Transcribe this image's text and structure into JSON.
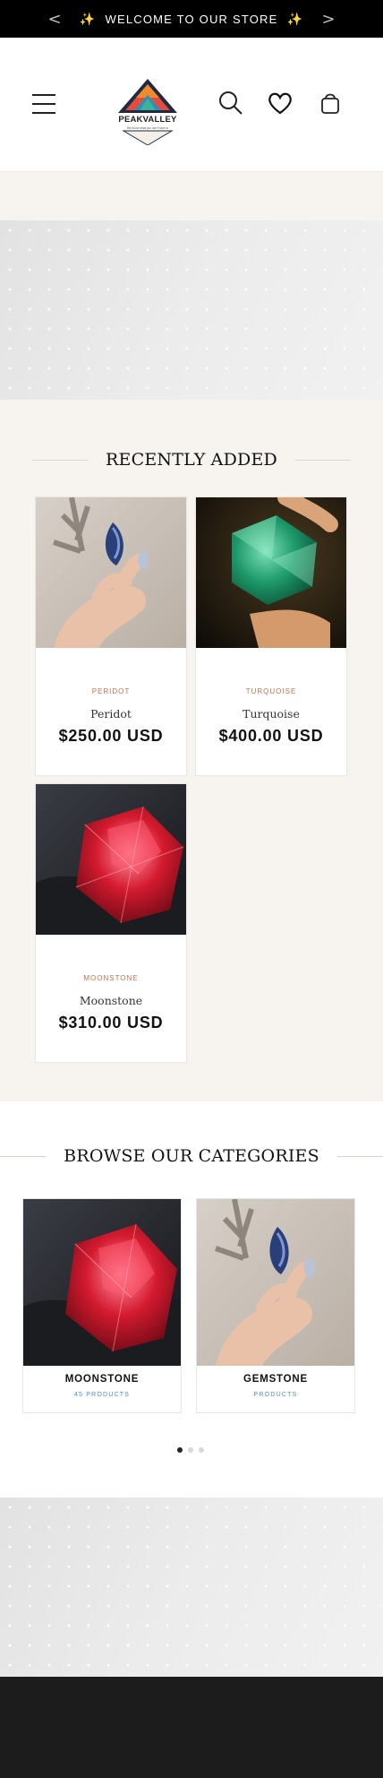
{
  "announcement": {
    "prev_label": "<",
    "next_label": ">",
    "spark_left": "✨",
    "text": "WELCOME TO OUR STORE",
    "spark_right": "✨"
  },
  "header": {
    "logo_text": "PEAKVALLEY",
    "logo_tagline": "We found what you don't have to",
    "icons": [
      "menu-icon",
      "search-icon",
      "heart-icon",
      "bag-icon"
    ]
  },
  "recent": {
    "title": "RECENTLY ADDED",
    "products": [
      {
        "vendor": "PERIDOT",
        "name": "Peridot",
        "price": "$250.00 USD",
        "image": "hand-holding-blue-gem"
      },
      {
        "vendor": "TURQUOISE",
        "name": "Turquoise",
        "price": "$400.00 USD",
        "image": "hand-holding-green-gem"
      },
      {
        "vendor": "MOONSTONE",
        "name": "Moonstone",
        "price": "$310.00 USD",
        "image": "red-faceted-gem"
      }
    ]
  },
  "categories": {
    "title": "BROWSE OUR CATEGORIES",
    "items": [
      {
        "name": "MOONSTONE",
        "count": "45 PRODUCTS",
        "image": "red-faceted-gem"
      },
      {
        "name": "GEMSTONE",
        "count": "PRODUCTS",
        "image": "hand-holding-blue-gem"
      }
    ],
    "slides": 3,
    "active_slide": 1
  },
  "colors": {
    "announcement_bg": "#000000",
    "section_bg": "#f7f3ef",
    "vendor_text": "#c0744e",
    "category_count": "#4a90c8",
    "footer_bg": "#1c1c1c"
  }
}
